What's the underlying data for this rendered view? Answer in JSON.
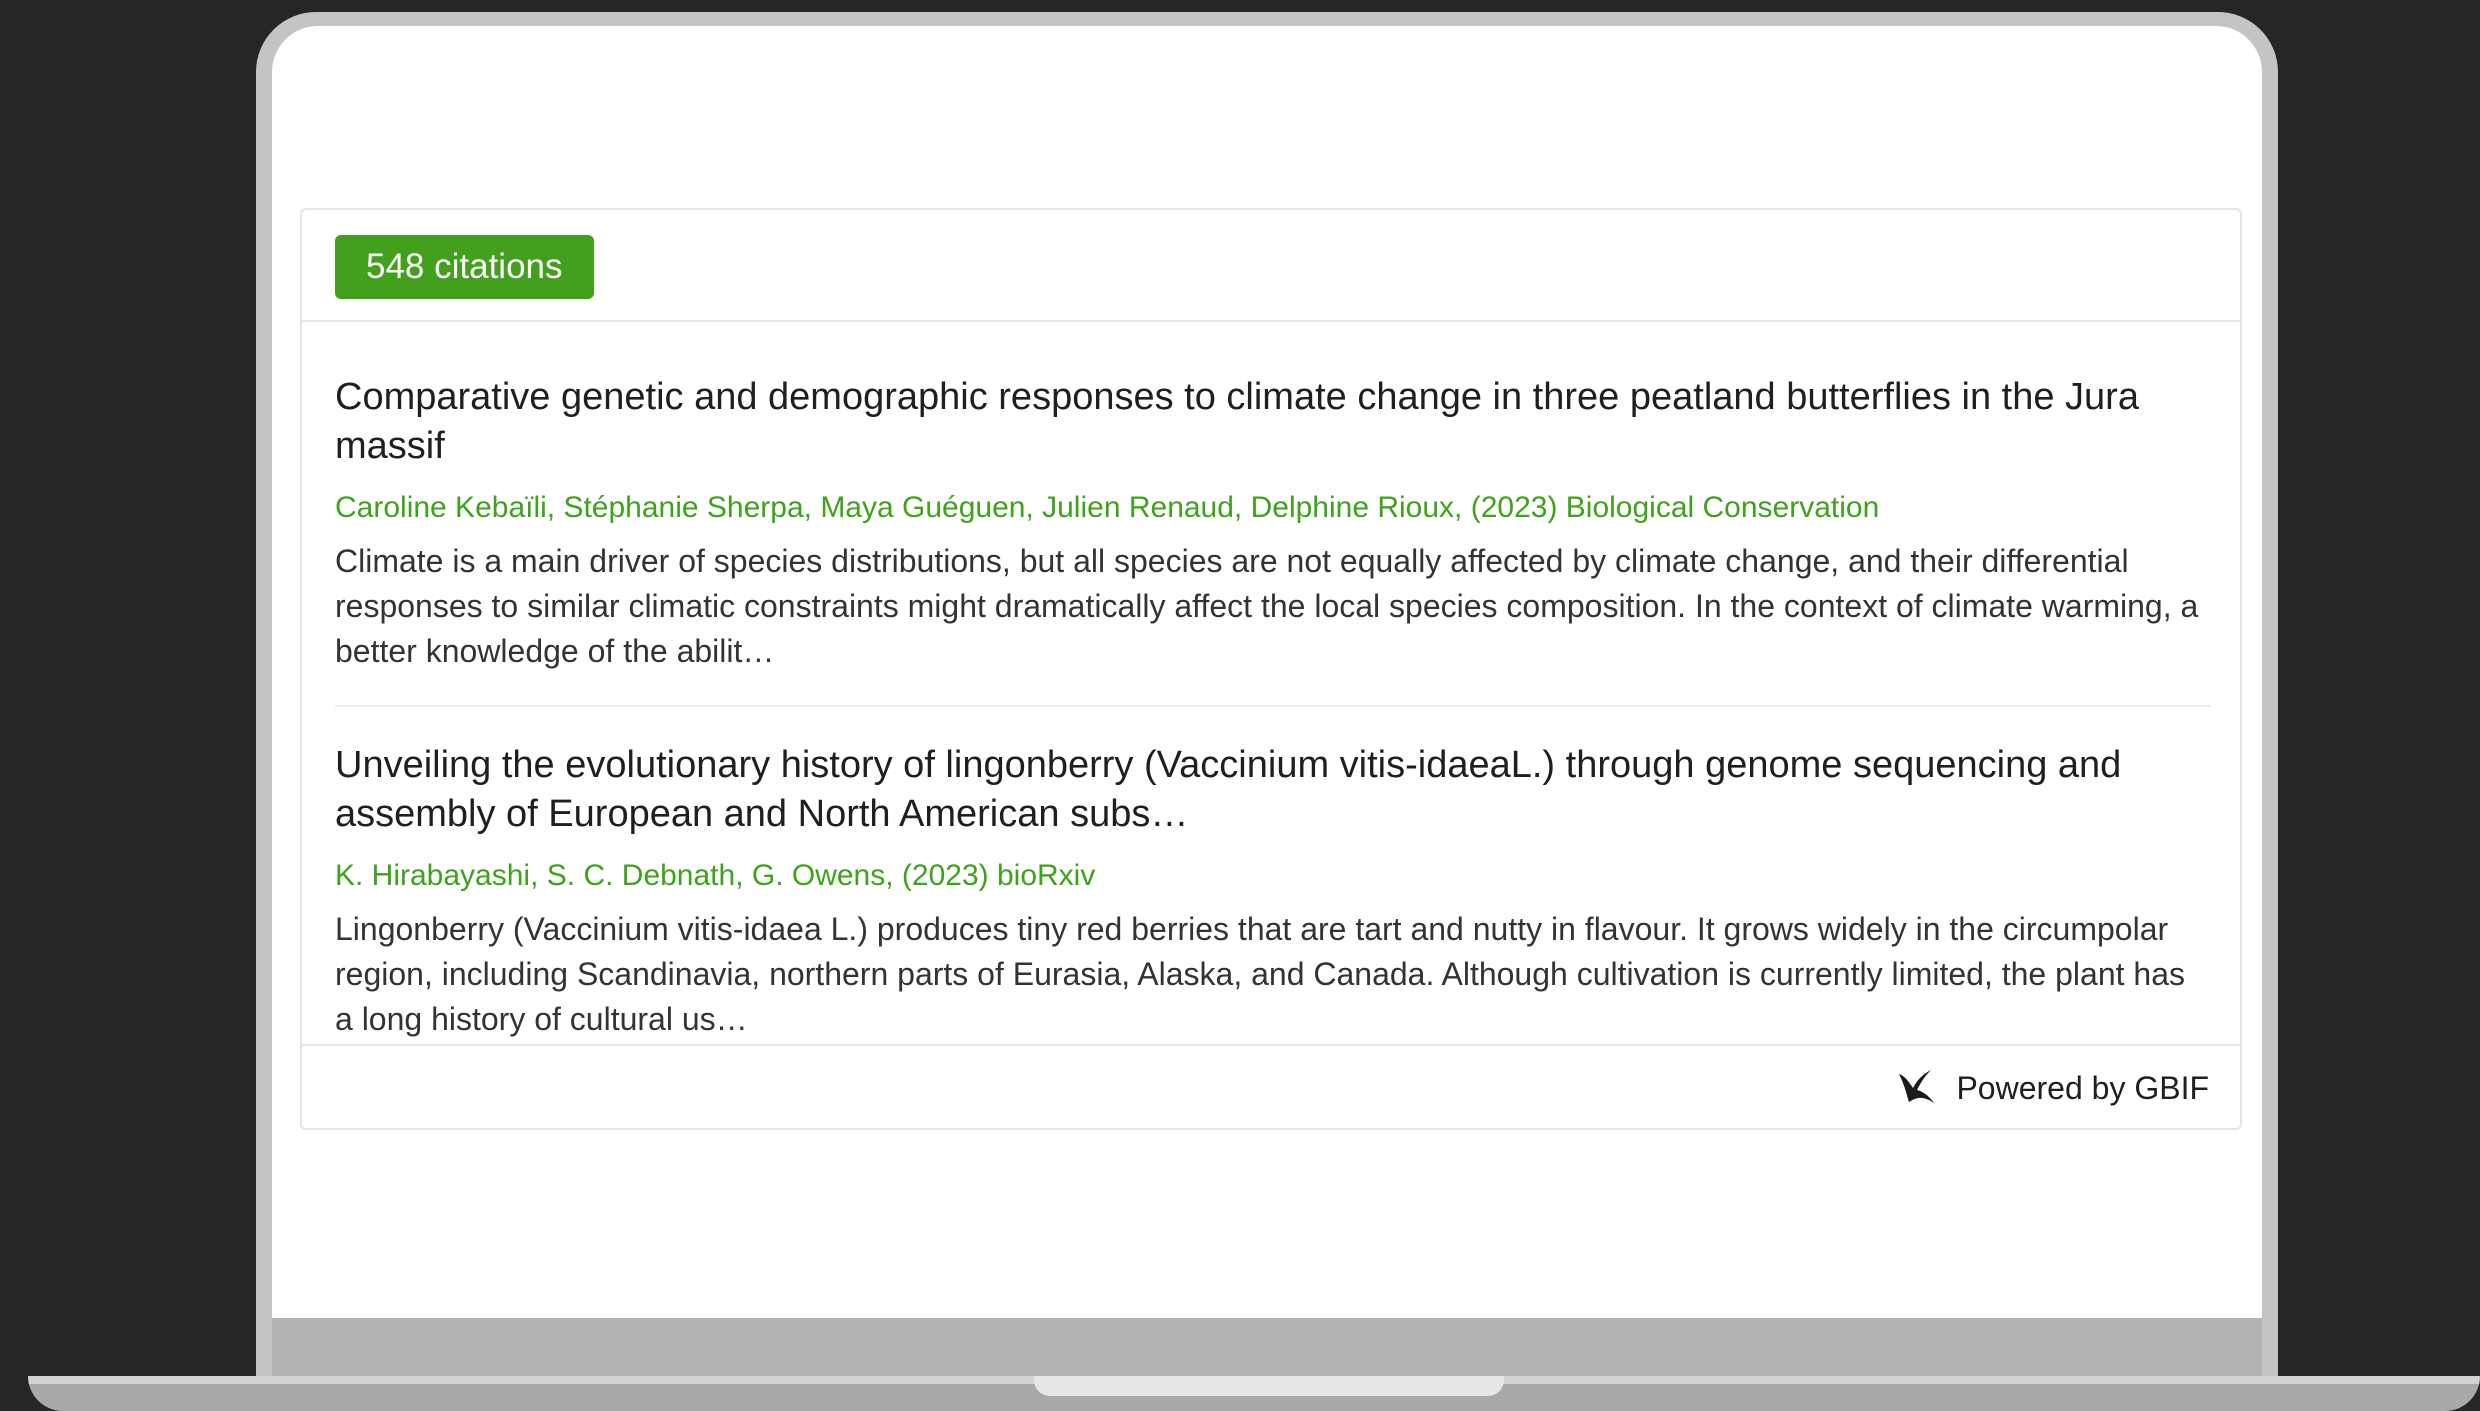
{
  "widget": {
    "citation_badge": "548 citations",
    "items": [
      {
        "title": "Comparative genetic and demographic responses to climate change in three peatland butterflies in the Jura massif",
        "meta": "Caroline Kebaïli, Stéphanie Sherpa, Maya Guéguen, Julien Renaud, Delphine Rioux, (2023) Biological Conservation",
        "abstract": "Climate is a main driver of species distributions, but all species are not equally affected by climate change, and their differential responses to similar climatic constraints might dramatically affect the local species composition. In the context of climate warming, a better knowledge of the abilit…"
      },
      {
        "title": "Unveiling the evolutionary history of lingonberry (Vaccinium vitis-idaeaL.) through genome sequencing and assembly of European and North American subs…",
        "meta": "K. Hirabayashi, S. C. Debnath, G. Owens, (2023) bioRxiv",
        "abstract": "Lingonberry (Vaccinium vitis-idaea L.) produces tiny red berries that are tart and nutty in flavour. It grows widely in the circumpolar region, including Scandinavia, northern parts of Eurasia, Alaska, and Canada. Although cultivation is currently limited, the plant has a long history of cultural us…"
      }
    ],
    "footer": {
      "powered_by": "Powered by GBIF",
      "icon": "gbif-logo-icon"
    }
  },
  "colors": {
    "badge_background": "#43a01c",
    "meta_text": "#3ea31a",
    "page_background": "#262626"
  }
}
